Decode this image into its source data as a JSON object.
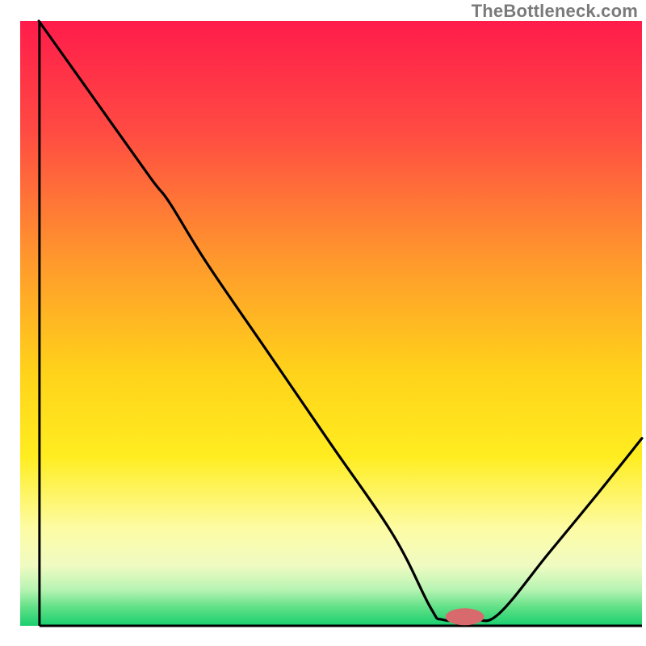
{
  "watermark": "TheBottleneck.com",
  "chart_data": {
    "type": "line",
    "title": "",
    "xlabel": "",
    "ylabel": "",
    "xlim": [
      0,
      100
    ],
    "ylim": [
      0,
      100
    ],
    "gradient_stops": [
      {
        "offset": 0,
        "color": "#ff1c4b"
      },
      {
        "offset": 18,
        "color": "#ff4a43"
      },
      {
        "offset": 40,
        "color": "#ff9a2c"
      },
      {
        "offset": 58,
        "color": "#ffd21a"
      },
      {
        "offset": 72,
        "color": "#ffed20"
      },
      {
        "offset": 84,
        "color": "#fdfca5"
      },
      {
        "offset": 90,
        "color": "#f0fbc2"
      },
      {
        "offset": 94,
        "color": "#b8f4b3"
      },
      {
        "offset": 97,
        "color": "#5fe086"
      },
      {
        "offset": 100,
        "color": "#19cf6e"
      }
    ],
    "series": [
      {
        "name": "bottleneck-curve",
        "points": [
          {
            "x": 3,
            "y": 100
          },
          {
            "x": 12,
            "y": 87
          },
          {
            "x": 21,
            "y": 74
          },
          {
            "x": 24,
            "y": 70
          },
          {
            "x": 30,
            "y": 60
          },
          {
            "x": 40,
            "y": 45
          },
          {
            "x": 50,
            "y": 30
          },
          {
            "x": 60,
            "y": 15
          },
          {
            "x": 66,
            "y": 3
          },
          {
            "x": 68,
            "y": 1
          },
          {
            "x": 73,
            "y": 1
          },
          {
            "x": 77,
            "y": 2
          },
          {
            "x": 85,
            "y": 12
          },
          {
            "x": 93,
            "y": 22
          },
          {
            "x": 100,
            "y": 31
          }
        ]
      }
    ],
    "marker": {
      "name": "optimal-zone",
      "x": 71.5,
      "y": 1.5,
      "rx": 3.1,
      "ry": 1.4,
      "color": "#d86a6d"
    },
    "axes": {
      "left": {
        "x": 3.1,
        "y1": 0,
        "y2": 100
      },
      "bottom": {
        "y": 0,
        "x1": 3.1,
        "x2": 100
      }
    }
  }
}
